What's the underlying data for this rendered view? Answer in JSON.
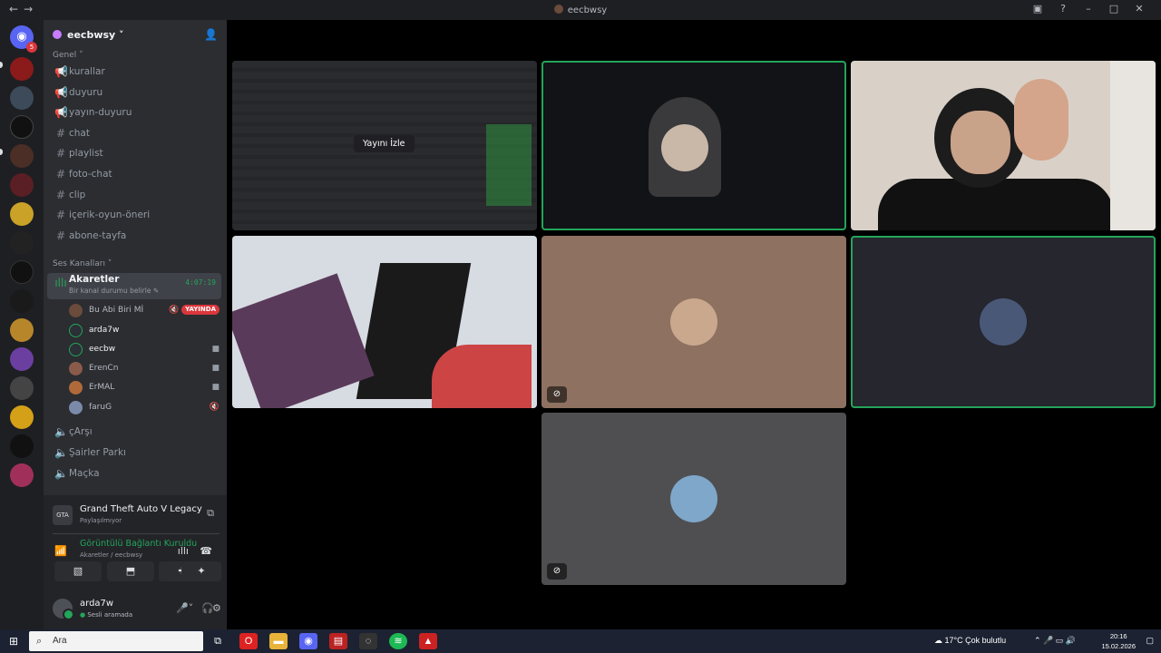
{
  "window": {
    "title": "eecbwsy",
    "back": "←",
    "forward": "→"
  },
  "server_badge": "5",
  "guild": {
    "name": "eecbwsy ˅"
  },
  "categories": {
    "general": "Genel ˅",
    "voice": "Ses Kanalları ˅"
  },
  "text_channels": [
    "kurallar",
    "duyuru",
    "yayın-duyuru",
    "chat",
    "playlist",
    "foto-chat",
    "clip",
    "içerik-oyun-öneri",
    "abone-tayfa"
  ],
  "voice_channel": {
    "name": "Akaretler",
    "timer": "4:07:19",
    "status": "Bir kanal durumu belirle ✎"
  },
  "voice_users": [
    {
      "name": "Bu Abi Biri Mİ",
      "live": "YAYINDA",
      "color": "#6a4b3c"
    },
    {
      "name": "arda7w",
      "color": "#2b2f36"
    },
    {
      "name": "eecbw",
      "color": "#2b2f36"
    },
    {
      "name": "ErenCn",
      "color": "#8a5a4a"
    },
    {
      "name": "ErMAL",
      "color": "#b06a3a"
    },
    {
      "name": "faruG",
      "color": "#7a8aa8"
    }
  ],
  "other_voice": [
    "çArşı",
    "Şairler Parkı",
    "Maçka"
  ],
  "activity": {
    "game": "Grand Theft Auto V Legacy",
    "sub": "Paylaşılmıyor",
    "icon": "GTA"
  },
  "connection": {
    "status": "Görüntülü Bağlantı Kuruldu",
    "where": "Akaretler / eecbwsy"
  },
  "user": {
    "name": "arda7w",
    "status": "Sesli aramada"
  },
  "stage": {
    "watch_label": "Yayını İzle"
  },
  "taskbar": {
    "search": "Ara",
    "weather": "17°C  Çok bulutlu",
    "time": "20:16",
    "date": "15.02.2026"
  }
}
